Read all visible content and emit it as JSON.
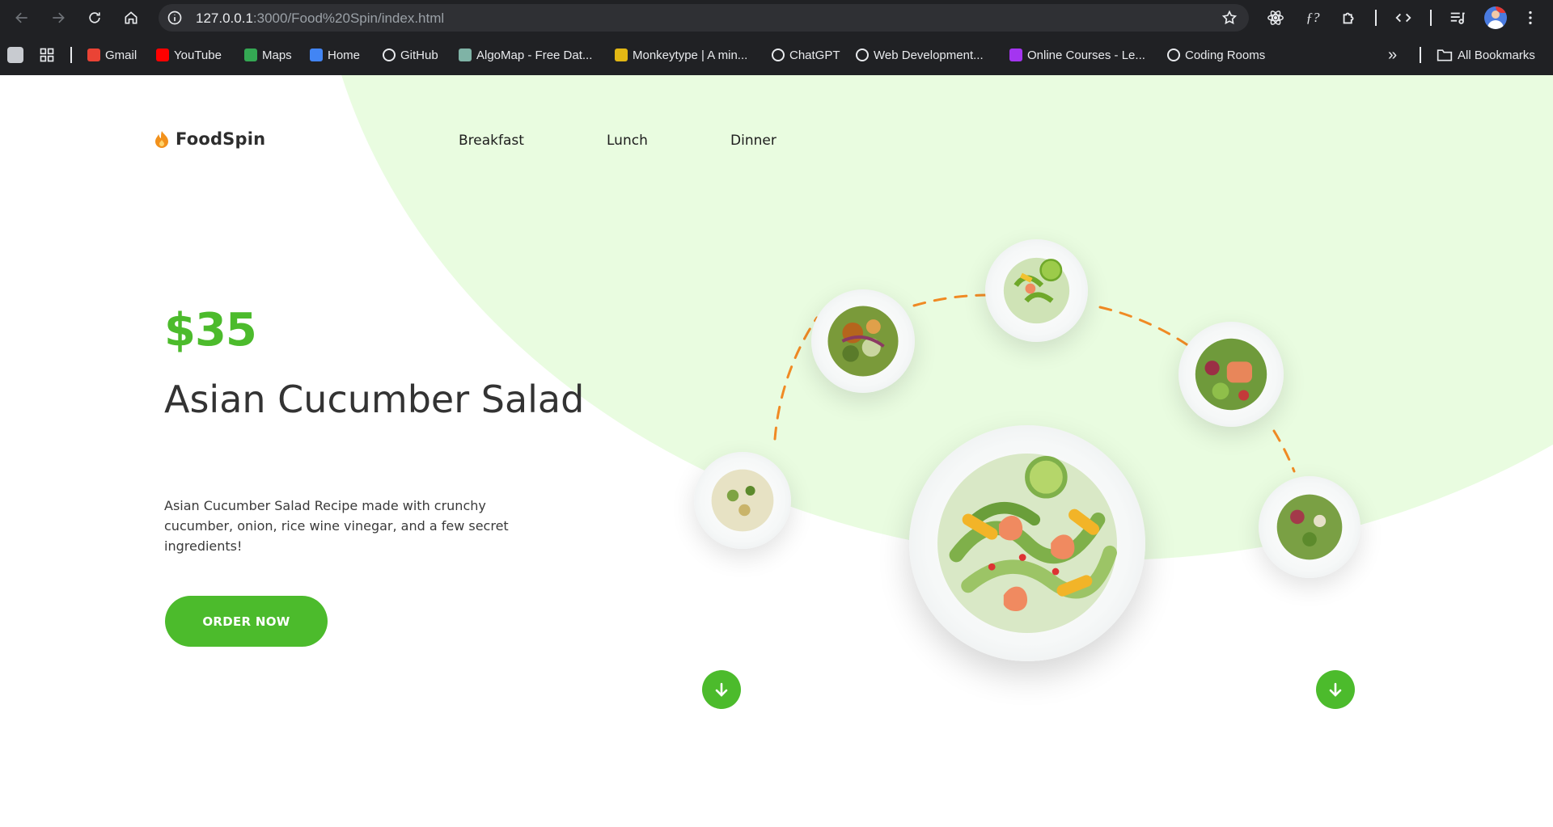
{
  "browser": {
    "url_host": "127.0.0.1",
    "url_path": ":3000/Food%20Spin/index.html",
    "bookmarks": [
      {
        "label": "Gmail",
        "icon": "gmail-icon",
        "color": "#ea4335"
      },
      {
        "label": "YouTube",
        "icon": "youtube-icon",
        "color": "#ff0000"
      },
      {
        "label": "Maps",
        "icon": "maps-icon",
        "color": "#34a853"
      },
      {
        "label": "Home",
        "icon": "google-icon",
        "color": "#4285f4"
      },
      {
        "label": "GitHub",
        "icon": "github-icon",
        "color": "#ffffff"
      },
      {
        "label": "AlgoMap - Free Dat...",
        "icon": "algomap-icon",
        "color": "#7fb3a6"
      },
      {
        "label": "Monkeytype | A min...",
        "icon": "monkeytype-icon",
        "color": "#e2b714"
      },
      {
        "label": "ChatGPT",
        "icon": "chatgpt-icon",
        "color": "#ffffff"
      },
      {
        "label": "Web Development...",
        "icon": "udemy-icon",
        "color": "#ffffff"
      },
      {
        "label": "Online Courses - Le...",
        "icon": "online-courses-icon",
        "color": "#a435f0"
      },
      {
        "label": "Coding Rooms",
        "icon": "coding-rooms-icon",
        "color": "#ffffff"
      }
    ],
    "all_bookmarks_label": "All Bookmarks",
    "overflow_label": "»"
  },
  "site": {
    "brand": "FoodSpin",
    "nav": [
      "Breakfast",
      "Lunch",
      "Dinner"
    ],
    "price": "$35",
    "title": "Asian Cucumber Salad",
    "description": "Asian Cucumber Salad Recipe made with crunchy cucumber, onion, rice wine vinegar, and a few secret ingredients!",
    "order_label": "ORDER NOW",
    "accent_color": "#4cbb2c",
    "background_tint": "#e9fce0",
    "arc_color": "#f08a24"
  }
}
